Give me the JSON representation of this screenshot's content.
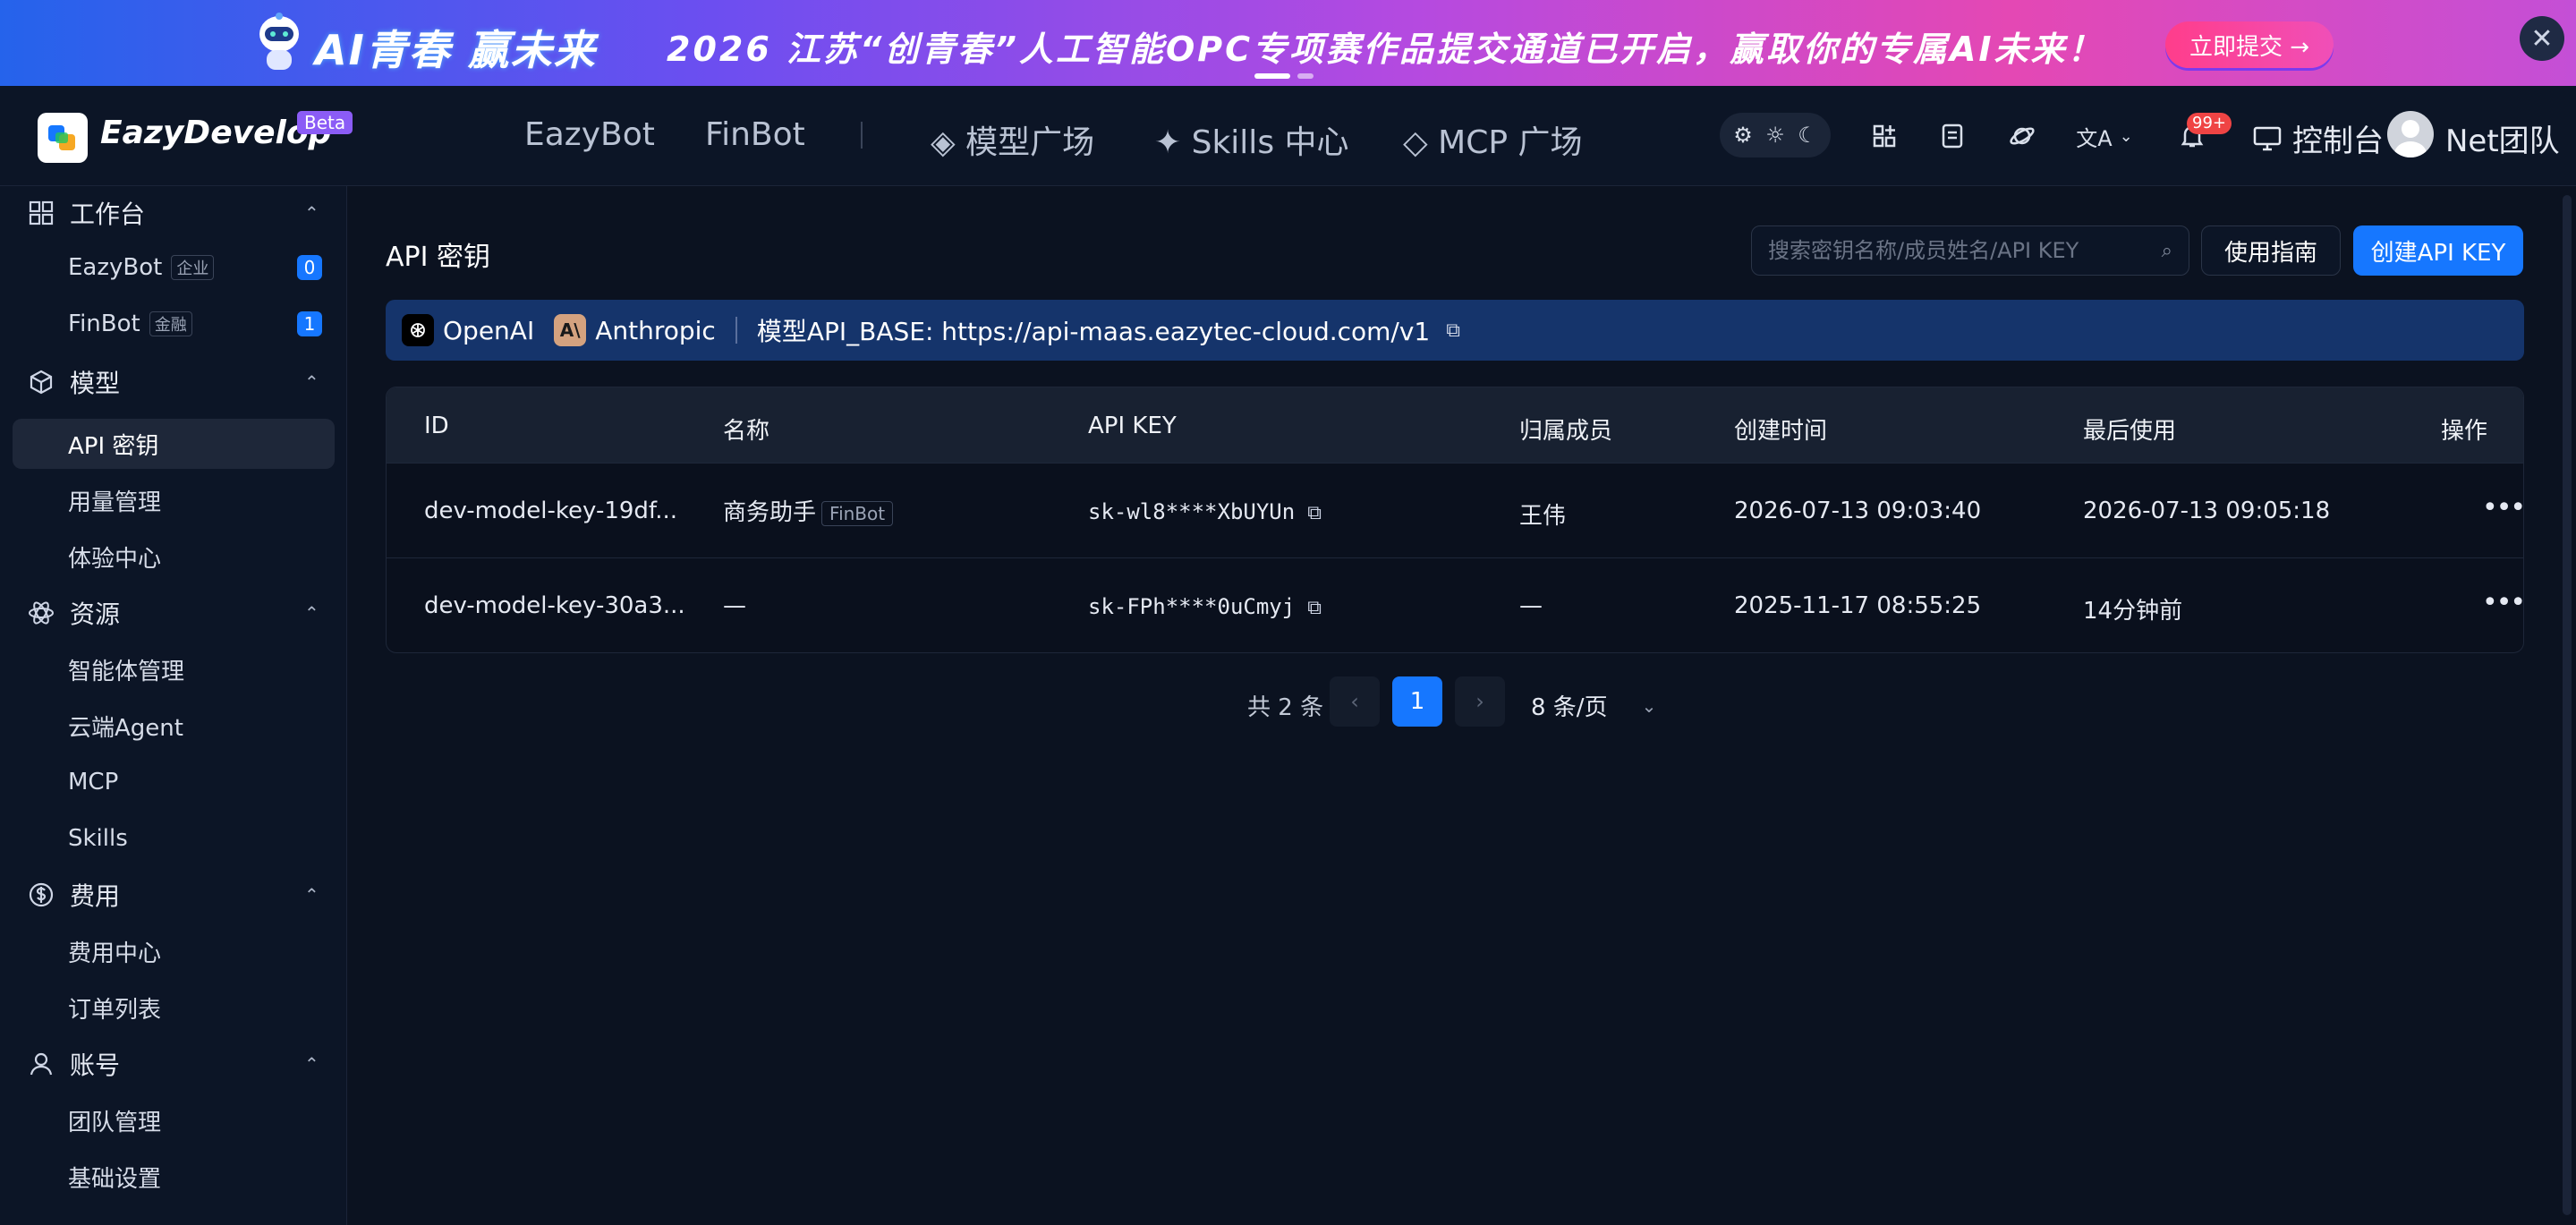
{
  "banner": {
    "slogan": "AI青春 赢未来",
    "headline": "2026 江苏“创青春”人工智能OPC专项赛作品提交通道已开启，赢取你的专属AI未来！",
    "submit_label": "立即提交 →",
    "close_glyph": "✕"
  },
  "topnav": {
    "brand": "EazyDevelop",
    "beta": "Beta",
    "links": [
      "EazyBot",
      "FinBot",
      "◈ 模型广场",
      "✦ Skills 中心",
      "◇ MCP 广场"
    ],
    "notif_count": "99+",
    "console_label": "控制台",
    "team_label": "Net团队"
  },
  "sidebar": {
    "groups": [
      {
        "label": "工作台",
        "icon": "grid-icon"
      },
      {
        "label": "模型",
        "icon": "cube-icon"
      },
      {
        "label": "资源",
        "icon": "atom-icon"
      },
      {
        "label": "费用",
        "icon": "dollar-icon"
      },
      {
        "label": "账号",
        "icon": "user-icon"
      }
    ],
    "items": [
      {
        "label": "EazyBot",
        "tag": "企业",
        "count": "0"
      },
      {
        "label": "FinBot",
        "tag": "金融",
        "count": "1"
      },
      {
        "label": "API 密钥"
      },
      {
        "label": "用量管理"
      },
      {
        "label": "体验中心"
      },
      {
        "label": "智能体管理"
      },
      {
        "label": "云端Agent"
      },
      {
        "label": "MCP"
      },
      {
        "label": "Skills"
      },
      {
        "label": "费用中心"
      },
      {
        "label": "订单列表"
      },
      {
        "label": "团队管理"
      },
      {
        "label": "基础设置"
      }
    ]
  },
  "main": {
    "title": "API 密钥",
    "search_placeholder": "搜索密钥名称/成员姓名/API KEY",
    "guide_label": "使用指南",
    "create_label": "创建API KEY",
    "info": {
      "openai": "OpenAI",
      "anthropic": "Anthropic",
      "api_base": "模型API_BASE: https://api-maas.eazytec-cloud.com/v1"
    },
    "table": {
      "headers": [
        "ID",
        "名称",
        "API KEY",
        "归属成员",
        "创建时间",
        "最后使用",
        "操作"
      ],
      "rows": [
        {
          "id": "dev-model-key-19df...",
          "name": "商务助手",
          "name_tag": "FinBot",
          "key": "sk-wl8****XbUYUn",
          "member": "王伟",
          "created": "2026-07-13 09:03:40",
          "last_used": "2026-07-13 09:05:18",
          "more": "•••"
        },
        {
          "id": "dev-model-key-30a3...",
          "name": "—",
          "name_tag": "",
          "key": "sk-FPh****0uCmyj",
          "member": "—",
          "created": "2025-11-17 08:55:25",
          "last_used": "14分钟前",
          "more": "•••"
        }
      ]
    },
    "pager": {
      "total": "共 2 条",
      "current": "1",
      "page_size": "8 条/页"
    }
  },
  "colors": {
    "accent": "#1677ff",
    "background": "#0b1220",
    "panel": "#0c1526",
    "info_bar": "#15346b"
  }
}
